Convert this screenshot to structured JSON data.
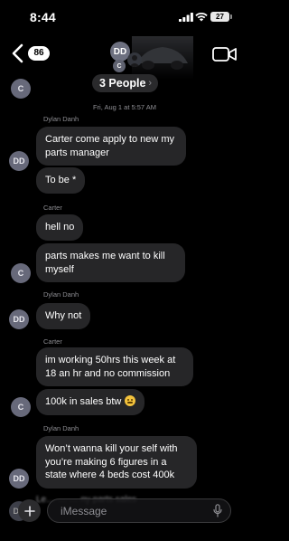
{
  "status_bar": {
    "time": "8:44",
    "battery": "27"
  },
  "header": {
    "back_count": "86",
    "group_initials": "DD",
    "group_initial_small": "C",
    "people_label": "3 People",
    "people_chevron": "›"
  },
  "timestamp": "Fri, Aug 1 at 5:57 AM",
  "messages": [
    {
      "sender": "",
      "text": ""
    },
    {
      "sender": "Dylan Danh",
      "text": "Carter come apply to new my parts manager"
    },
    {
      "sender": "",
      "text": "To be *"
    },
    {
      "sender": "Carter",
      "text": "hell no"
    },
    {
      "sender": "",
      "text": "parts makes me want to kill myself"
    },
    {
      "sender": "Dylan Danh",
      "text": "Why not"
    },
    {
      "sender": "Carter",
      "text": "im working 50hrs this week at 18 an hr and no commission"
    },
    {
      "sender": "",
      "text": "100k in sales btw"
    },
    {
      "sender": "Dylan Danh",
      "text": "Won’t wanna kill your self with you’re making 6 figures  in a state where 4 beds cost 400k"
    }
  ],
  "avatars": {
    "carter": "C",
    "dylan": "DD"
  },
  "composer": {
    "placeholder": "iMessage",
    "ghost_text": "Le… … … ny parts sales"
  },
  "colors": {
    "background": "#000000",
    "bubble": "#262628",
    "avatar": "#67697a",
    "meta_text": "#8e8e93"
  }
}
